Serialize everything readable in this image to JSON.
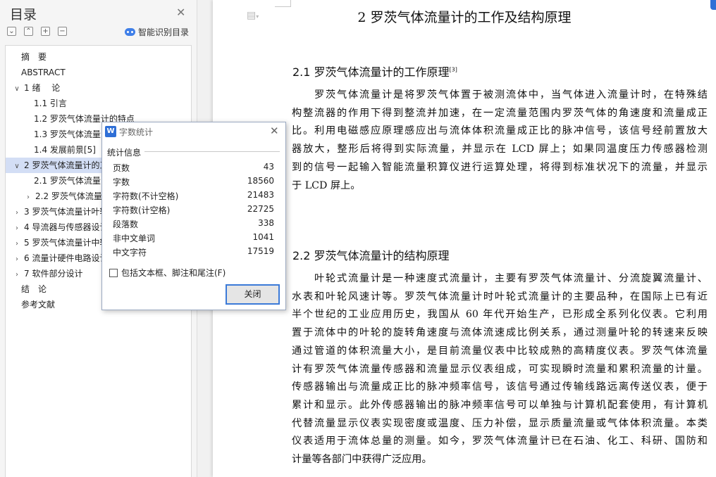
{
  "toc": {
    "title": "目录",
    "smart_toc_label": "智能识别目录",
    "items": [
      {
        "label": "摘　要",
        "level": 1,
        "caret": ""
      },
      {
        "label": "ABSTRACT",
        "level": 1,
        "caret": ""
      },
      {
        "label": "1 绪　 论",
        "level": 1,
        "caret": "∨"
      },
      {
        "label": "1.1 引言",
        "level": 2,
        "caret": ""
      },
      {
        "label": "1.2 罗茨气体流量计的特点",
        "level": 2,
        "caret": ""
      },
      {
        "label": "1.3 罗茨气体流量",
        "level": 2,
        "caret": ""
      },
      {
        "label": "1.4 发展前景[5]",
        "level": 2,
        "caret": ""
      },
      {
        "label": "2 罗茨气体流量计的工",
        "level": 1,
        "caret": "∨",
        "selected": true
      },
      {
        "label": "2.1 罗茨气体流量",
        "level": 2,
        "caret": ""
      },
      {
        "label": "2.2 罗茨气体流量计",
        "level": 2,
        "caret": "›"
      },
      {
        "label": "3 罗茨气体流量计叶轮",
        "level": 1,
        "caret": "›"
      },
      {
        "label": "4 导流器与传感器设计",
        "level": 1,
        "caret": "›"
      },
      {
        "label": "5 罗茨气体流量计中轮",
        "level": 1,
        "caret": "›"
      },
      {
        "label": "6 流量计硬件电路设计",
        "level": 1,
        "caret": "›"
      },
      {
        "label": "7 软件部分设计",
        "level": 1,
        "caret": "›"
      },
      {
        "label": "结　论",
        "level": 1,
        "caret": ""
      },
      {
        "label": "参考文献",
        "level": 1,
        "caret": ""
      }
    ]
  },
  "dialog": {
    "title": "字数统计",
    "section_label": "统计信息",
    "stats": [
      {
        "label": "页数",
        "value": "43"
      },
      {
        "label": "字数",
        "value": "18560"
      },
      {
        "label": "字符数(不计空格)",
        "value": "21483"
      },
      {
        "label": "字符数(计空格)",
        "value": "22725"
      },
      {
        "label": "段落数",
        "value": "338"
      },
      {
        "label": "非中文单词",
        "value": "1041"
      },
      {
        "label": "中文字符",
        "value": "17519"
      }
    ],
    "checkbox_label": "包括文本框、脚注和尾注(F)",
    "checkbox_checked": false,
    "close_button": "关闭"
  },
  "document": {
    "chapter_title": "2 罗茨气体流量计的工作及结构原理",
    "sec1_heading": "2.1  罗茨气体流量计的工作原理",
    "sec1_ref": "[3]",
    "sec1_lines": [
      "　　罗茨气体流量计是将罗茨气体置于被测流体中，当气体进入流量计时，在特殊结",
      "构整流器的作用下得到整流并加速，在一定流量范围内罗茨气体的角速度和流量成正",
      "比。利用电磁感应原理感应出与流体体积流量成正比的脉冲信号，该信号经前置放大",
      "器放大，整形后将得到实际流量，并显示在 LCD 屏上；如果同温度压力传感器检测",
      "到的信号一起输入智能流量积算仪进行运算处理，将得到标准状况下的流量，并显示",
      "于 LCD 屏上。"
    ],
    "sec2_heading": "2.2 罗茨气体流量计的结构原理",
    "sec2_lines": [
      "　　叶轮式流量计是一种速度式流量计，主要有罗茨气体流量计、分流旋翼流量计、",
      "水表和叶轮风速计等。罗茨气体流量计时叶轮式流量计的主要品种，在国际上已有近",
      "半个世纪的工业应用历史，我国从 60 年代开始生产，已形成全系列化仪表。它利用",
      "置于流体中的叶轮的旋转角速度与流体流速成比例关系，通过测量叶轮的转速来反映",
      "通过管道的体积流量大小，是目前流量仪表中比较成熟的高精度仪表。罗茨气体流量",
      "计有罗茨气体流量传感器和流量显示仪表组成，可实现瞬时流量和累积流量的计量。",
      "传感器输出与流量成正比的脉冲频率信号，该信号通过传输线路远离传送仪表，便于",
      "累计和显示。此外传感器输出的脉冲频率信号可以单独与计算机配套使用，有计算机",
      "代替流量显示仪表实现密度或温度、压力补偿，显示质量流量或气体体积流量。本类",
      "仪表适用于流体总量的测量。如今，罗茨气体流量计已在石油、化工、科研、国防和",
      "计量等各部门中获得广泛应用。"
    ]
  },
  "colors": {
    "selection": "#d3def5",
    "accent": "#3b7ad8",
    "app_icon": "#2f6fd6"
  }
}
